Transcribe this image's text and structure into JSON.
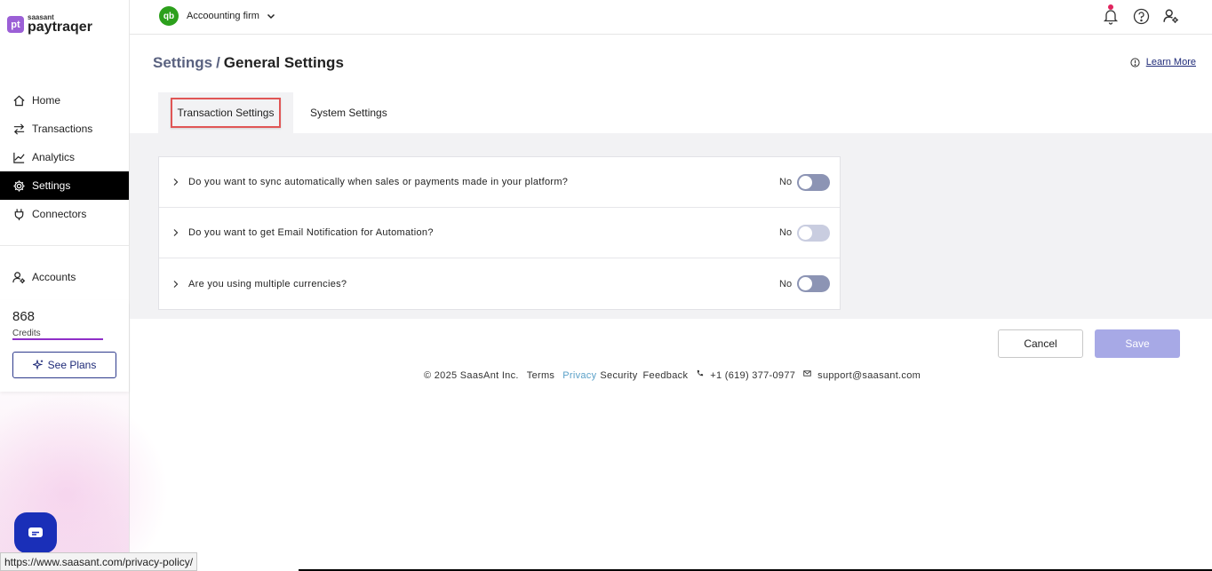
{
  "brand": {
    "logo_mark": "pt",
    "logo_small": "saasant",
    "logo_big": "paytraqer"
  },
  "sidebar": {
    "items": [
      {
        "label": "Home",
        "icon": "home-icon"
      },
      {
        "label": "Transactions",
        "icon": "transfer-arrows-icon"
      },
      {
        "label": "Analytics",
        "icon": "line-chart-icon"
      },
      {
        "label": "Settings",
        "icon": "gear-icon",
        "active": true
      },
      {
        "label": "Connectors",
        "icon": "plug-icon"
      }
    ],
    "accounts_label": "Accounts",
    "credits": {
      "value": "868",
      "label": "Credits",
      "bar_fill_fraction": 1.0
    },
    "see_plans_label": "See Plans"
  },
  "topbar": {
    "company_logo": "qb",
    "company_name": "Accoounting firm"
  },
  "header": {
    "breadcrumb_parent": "Settings",
    "breadcrumb_sep": "/",
    "breadcrumb_current": "General Settings",
    "learn_more": "Learn More"
  },
  "tabs": [
    {
      "label": "Transaction Settings",
      "active": true
    },
    {
      "label": "System Settings",
      "active": false
    }
  ],
  "settings": [
    {
      "question": "Do you want to sync automatically when sales or payments made in your platform?",
      "value": "No",
      "enabled": false
    },
    {
      "question": "Do you want to get Email Notification for Automation?",
      "value": "No",
      "enabled": false
    },
    {
      "question": "Are you using multiple currencies?",
      "value": "No",
      "enabled": false
    }
  ],
  "actions": {
    "cancel_label": "Cancel",
    "save_label": "Save"
  },
  "footer": {
    "copyright": "© 2025 SaasAnt Inc.",
    "terms": "Terms",
    "privacy": "Privacy",
    "security": "Security",
    "feedback": "Feedback",
    "phone": "+1 (619) 377-0977",
    "email": "support@saasant.com"
  },
  "status_bar_url": "https://www.saasant.com/privacy-policy/",
  "colors": {
    "active_nav_bg": "#000000",
    "toggle_off": "#8c94b4",
    "save_disabled": "#a7a9e6",
    "accent_purple": "#8f2fc8",
    "qb_green": "#2ca01c"
  }
}
